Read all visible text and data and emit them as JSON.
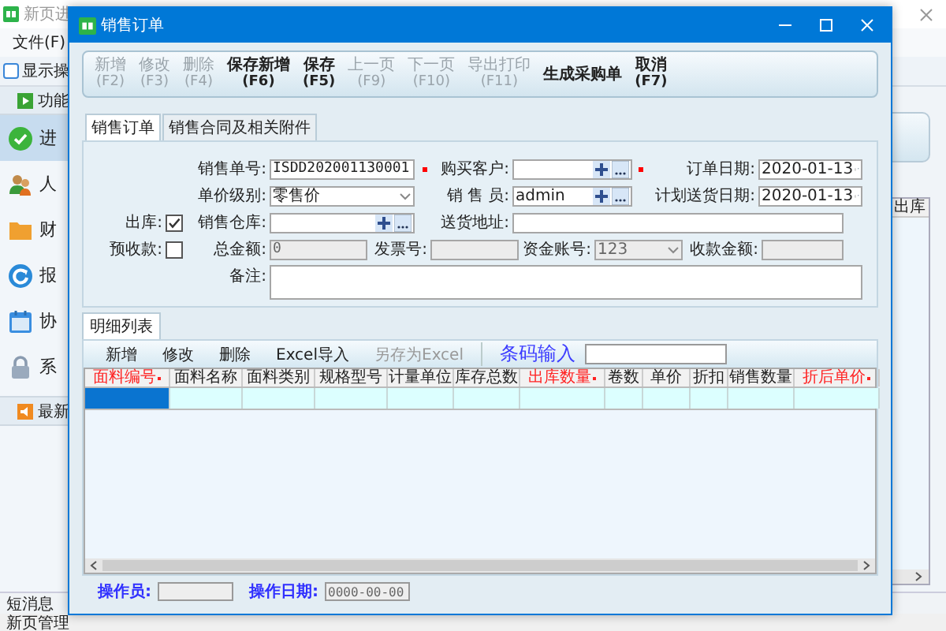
{
  "main_window": {
    "title": "新页进",
    "menu": [
      "文件(F)"
    ],
    "show_option": {
      "label": "显示操",
      "checked": false
    },
    "sidebar": {
      "header": "功能",
      "items": [
        {
          "label": "进",
          "selected": true
        },
        {
          "label": "人",
          "selected": false
        },
        {
          "label": "财",
          "selected": false
        },
        {
          "label": "报",
          "selected": false
        },
        {
          "label": "协",
          "selected": false
        },
        {
          "label": "系",
          "selected": false
        }
      ],
      "section": "最新"
    },
    "grid_header": "出库",
    "bottom_tab": "短消息",
    "status_bar": "新页管理"
  },
  "dialog": {
    "title": "销售订单",
    "toolbar": [
      {
        "label": "新增",
        "key": "(F2)",
        "disabled": true
      },
      {
        "label": "修改",
        "key": "(F3)",
        "disabled": true
      },
      {
        "label": "删除",
        "key": "(F4)",
        "disabled": true
      },
      {
        "label": "保存新增",
        "key": "(F6)",
        "disabled": false
      },
      {
        "label": "保存",
        "key": "(F5)",
        "disabled": false
      },
      {
        "label": "上一页",
        "key": "(F9)",
        "disabled": true
      },
      {
        "label": "下一页",
        "key": "(F10)",
        "disabled": true
      },
      {
        "label": "导出打印",
        "key": "(F11)",
        "disabled": true
      },
      {
        "label": "生成采购单",
        "disabled": false
      },
      {
        "label": "取消",
        "key": "(F7)",
        "disabled": false
      }
    ],
    "tabs": [
      {
        "label": "销售订单",
        "selected": true
      },
      {
        "label": "销售合同及相关附件",
        "selected": false
      }
    ],
    "form": {
      "rows": [
        [
          "",
          {
            "label": "销售单号:",
            "kind": "text",
            "value": "ISDD202001130001",
            "required": true,
            "disabled": false
          },
          {
            "label": "购买客户:",
            "kind": "lookup",
            "required": true,
            "disabled": false
          },
          {
            "label": "订单日期:",
            "kind": "date",
            "value": "2020-01-13",
            "disabled": false
          }
        ],
        [
          "",
          {
            "label": "单价级别:",
            "kind": "combo",
            "value": "零售价",
            "disabled": false
          },
          {
            "label": "销 售 员:",
            "kind": "lookup",
            "value": "admin",
            "disabled": false
          },
          {
            "label": "计划送货日期:",
            "kind": "date",
            "value": "2020-01-13",
            "disabled": false
          }
        ],
        [
          {
            "label": "出库:",
            "kind": "check",
            "checked": true
          },
          {
            "label": "销售仓库:",
            "kind": "lookup",
            "disabled": false
          },
          {
            "label": "送货地址:",
            "kind": "text",
            "disabled": false
          }
        ],
        [
          {
            "label": "预收款:",
            "kind": "check",
            "checked": false
          },
          {
            "label": "总金额:",
            "kind": "text",
            "value": "0",
            "disabled": true
          },
          {
            "label": "发票号:",
            "kind": "text",
            "disabled": true
          },
          {
            "label": "资金账号:",
            "kind": "combo",
            "value": "123",
            "disabled": true
          },
          {
            "label": "收款金额:",
            "kind": "text",
            "disabled": true
          }
        ],
        [
          "",
          {
            "label": "备注:",
            "kind": "textarea",
            "disabled": false
          }
        ]
      ]
    },
    "detail": {
      "tab": "明细列表",
      "toolbar": [
        {
          "label": "新增",
          "disabled": false
        },
        {
          "label": "修改",
          "disabled": false
        },
        {
          "label": "删除",
          "disabled": false
        },
        {
          "label": "Excel导入",
          "disabled": false
        },
        {
          "label": "另存为Excel",
          "disabled": true
        }
      ],
      "barcode_label": "条码输入",
      "columns": [
        {
          "label": "面料编号",
          "required": true
        },
        {
          "label": "面料名称",
          "required": false
        },
        {
          "label": "面料类别",
          "required": false
        },
        {
          "label": "规格型号",
          "required": false
        },
        {
          "label": "计量单位",
          "required": false
        },
        {
          "label": "库存总数",
          "required": false
        },
        {
          "label": "出库数量",
          "required": true
        },
        {
          "label": "卷数",
          "required": false
        },
        {
          "label": "单价",
          "required": false
        },
        {
          "label": "折扣",
          "required": false
        },
        {
          "label": "销售数量",
          "required": false
        },
        {
          "label": "折后单价",
          "required": true
        }
      ],
      "rows": [
        {
          "cells": [
            {
              "selected": true
            },
            {
              "selected": false
            },
            {
              "selected": false
            },
            {
              "selected": false
            },
            {
              "selected": false
            },
            {
              "selected": false
            },
            {
              "selected": false
            },
            {
              "selected": false
            },
            {
              "selected": false
            },
            {
              "selected": false
            },
            {
              "selected": false
            },
            {
              "selected": false
            }
          ]
        }
      ]
    },
    "footer": {
      "operator_label": "操作员:",
      "date_label": "操作日期:",
      "date_value": "0000-00-00"
    }
  }
}
